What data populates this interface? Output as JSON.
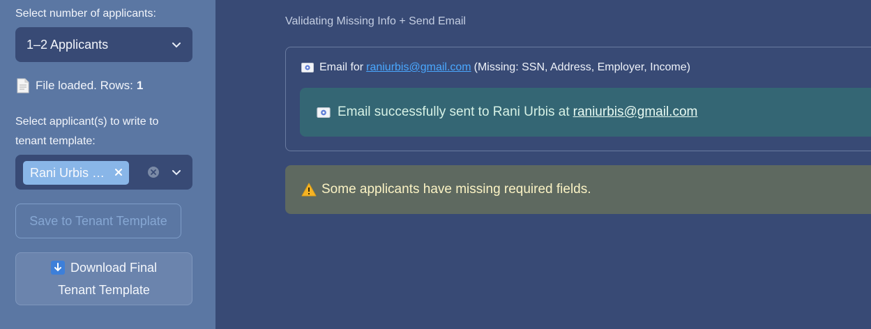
{
  "sidebar": {
    "applicant_count_label": "Select number of applicants:",
    "applicant_count_value": "1–2 Applicants",
    "file_status_text": "File loaded. Rows:",
    "file_rows": "1",
    "applicant_select_label_line1": "Select applicant(s) to write to",
    "applicant_select_label_line2": "tenant template:",
    "selected_applicant_tag": "Rani Urbis …",
    "save_button_label": "Save to Tenant Template",
    "download_button_line1": "Download Final",
    "download_button_line2": "Tenant Template"
  },
  "main": {
    "section_title": "Validating Missing Info + Send Email",
    "email_prefix": "Email for",
    "email_address": "raniurbis@gmail.com",
    "email_missing": "(Missing: SSN, Address, Employer, Income)",
    "success_prefix": "Email successfully sent to Rani Urbis at",
    "success_email": "raniurbis@gmail.com",
    "warning_text": "Some applicants have missing required fields."
  },
  "colors": {
    "sidebar_bg": "#5b77a3",
    "main_bg": "#384a75",
    "success_bg": "#346674",
    "warning_bg": "#5e6960",
    "link": "#4aa8ff",
    "tag_bg": "#89b6e8"
  },
  "icons": {
    "file": "document-icon",
    "envelope": "envelope-icon",
    "warning": "warning-triangle-icon",
    "download": "down-arrow-icon"
  }
}
